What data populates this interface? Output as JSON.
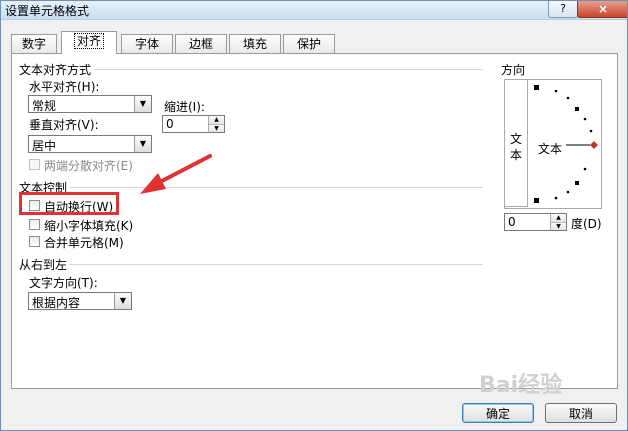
{
  "window": {
    "title": "设置单元格格式",
    "help": "?",
    "close": "×"
  },
  "tabs": [
    {
      "label": "数字"
    },
    {
      "label": "对齐"
    },
    {
      "label": "字体"
    },
    {
      "label": "边框"
    },
    {
      "label": "填充"
    },
    {
      "label": "保护"
    }
  ],
  "text_align": {
    "section": "文本对齐方式",
    "horizontal_label": "水平对齐(H):",
    "horizontal_value": "常规",
    "indent_label": "缩进(I):",
    "indent_value": "0",
    "vertical_label": "垂直对齐(V):",
    "vertical_value": "居中",
    "justify_distributed": "两端分散对齐(E)"
  },
  "text_control": {
    "section": "文本控制",
    "wrap_text": "自动换行(W)",
    "shrink_to_fit": "缩小字体填充(K)",
    "merge_cells": "合并单元格(M)"
  },
  "rtl": {
    "section": "从右到左",
    "direction_label": "文字方向(T):",
    "direction_value": "根据内容"
  },
  "orientation": {
    "section": "方向",
    "vertical_text_1": "文",
    "vertical_text_2": "本",
    "dial_text": "文本",
    "degrees_value": "0",
    "degrees_label": "度(D)"
  },
  "buttons": {
    "ok": "确定",
    "cancel": "取消"
  },
  "watermark": "Bai经验"
}
